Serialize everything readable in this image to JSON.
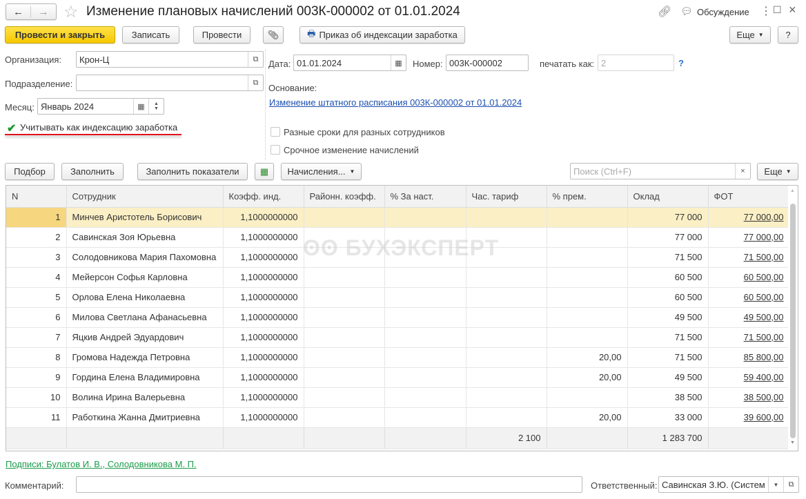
{
  "window": {
    "title": "Изменение плановых начислений 003К-000002 от 01.01.2024",
    "discussion": "Обсуждение"
  },
  "toolbar": {
    "post_close": "Провести и закрыть",
    "save": "Записать",
    "post": "Провести",
    "print_order": "Приказ об индексации заработка",
    "more": "Еще",
    "help": "?"
  },
  "form": {
    "org_label": "Организация:",
    "org_value": "Крон-Ц",
    "dept_label": "Подразделение:",
    "dept_value": "",
    "month_label": "Месяц:",
    "month_value": "Январь 2024",
    "indexation_label": "Учитывать как индексацию заработка",
    "indexation_checked": true,
    "date_label": "Дата:",
    "date_value": "01.01.2024",
    "number_label": "Номер:",
    "number_value": "003К-000002",
    "print_as_label": "печатать как:",
    "print_as_value": "2",
    "print_as_help": "?",
    "basis_label": "Основание:",
    "basis_link": "Изменение штатного расписания 003К-000002 от 01.01.2024",
    "diff_dates_label": "Разные сроки для разных сотрудников",
    "diff_dates_checked": false,
    "urgent_label": "Срочное изменение начислений",
    "urgent_checked": false
  },
  "table_toolbar": {
    "pick": "Подбор",
    "fill": "Заполнить",
    "fill_indicators": "Заполнить показатели",
    "accruals": "Начисления...",
    "search_placeholder": "Поиск (Ctrl+F)",
    "clear": "×",
    "more": "Еще"
  },
  "table": {
    "columns": [
      "N",
      "Сотрудник",
      "Коэфф. инд.",
      "Районн. коэфф.",
      "%  За наст.",
      "Час. тариф",
      "% прем.",
      "Оклад",
      "ФОТ"
    ],
    "rows": [
      [
        "1",
        "Минчев Аристотель Борисович",
        "1,1000000000",
        "",
        "",
        "",
        "",
        "77 000",
        "77 000,00"
      ],
      [
        "2",
        "Савинская Зоя Юрьевна",
        "1,1000000000",
        "",
        "",
        "",
        "",
        "77 000",
        "77 000,00"
      ],
      [
        "3",
        "Солодовникова Мария Пахомовна",
        "1,1000000000",
        "",
        "",
        "",
        "",
        "71 500",
        "71 500,00"
      ],
      [
        "4",
        "Мейерсон Софья Карловна",
        "1,1000000000",
        "",
        "",
        "",
        "",
        "60 500",
        "60 500,00"
      ],
      [
        "5",
        "Орлова Елена Николаевна",
        "1,1000000000",
        "",
        "",
        "",
        "",
        "60 500",
        "60 500,00"
      ],
      [
        "6",
        "Милова Светлана Афанасьевна",
        "1,1000000000",
        "",
        "",
        "",
        "",
        "49 500",
        "49 500,00"
      ],
      [
        "7",
        "Яцкив Андрей Эдуардович",
        "1,1000000000",
        "",
        "",
        "",
        "",
        "71 500",
        "71 500,00"
      ],
      [
        "8",
        "Громова Надежда Петровна",
        "1,1000000000",
        "",
        "",
        "",
        "20,00",
        "71 500",
        "85 800,00"
      ],
      [
        "9",
        "Гордина Елена Владимировна",
        "1,1000000000",
        "",
        "",
        "",
        "20,00",
        "49 500",
        "59 400,00"
      ],
      [
        "10",
        "Волина Ирина Валерьевна",
        "1,1000000000",
        "",
        "",
        "",
        "",
        "38 500",
        "38 500,00"
      ],
      [
        "11",
        "Работкина Жанна Дмитриевна",
        "1,1000000000",
        "",
        "",
        "",
        "20,00",
        "33 000",
        "39 600,00"
      ]
    ],
    "totals": [
      "",
      "",
      "",
      "",
      "",
      "2 100",
      "",
      "1 283 700",
      ""
    ]
  },
  "watermark": "БУХЭКСПЕРТ",
  "footer": {
    "signatures": "Подписи: Булатов И. В., Солодовникова М. П.",
    "comment_label": "Комментарий:",
    "comment_value": "",
    "responsible_label": "Ответственный:",
    "responsible_value": "Савинская З.Ю. (Систем"
  }
}
